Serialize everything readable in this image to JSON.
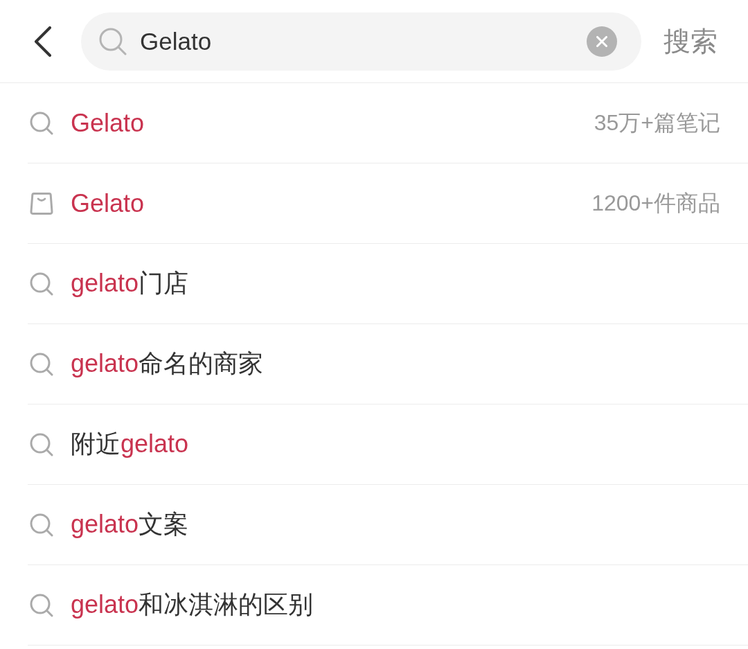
{
  "search": {
    "value": "Gelato",
    "submit_label": "搜索"
  },
  "suggestions": [
    {
      "kind": "search",
      "parts": [
        {
          "text": "Gelato",
          "highlighted": true
        }
      ],
      "count": "35万+篇笔记"
    },
    {
      "kind": "product",
      "parts": [
        {
          "text": "Gelato",
          "highlighted": true
        }
      ],
      "count": "1200+件商品"
    },
    {
      "kind": "search",
      "parts": [
        {
          "text": "gelato",
          "highlighted": true
        },
        {
          "text": "门店",
          "highlighted": false
        }
      ]
    },
    {
      "kind": "search",
      "parts": [
        {
          "text": "gelato",
          "highlighted": true
        },
        {
          "text": "命名的商家",
          "highlighted": false
        }
      ]
    },
    {
      "kind": "search",
      "parts": [
        {
          "text": "附近",
          "highlighted": false
        },
        {
          "text": "gelato",
          "highlighted": true
        }
      ]
    },
    {
      "kind": "search",
      "parts": [
        {
          "text": "gelato",
          "highlighted": true
        },
        {
          "text": "文案",
          "highlighted": false
        }
      ]
    },
    {
      "kind": "search",
      "parts": [
        {
          "text": "gelato",
          "highlighted": true
        },
        {
          "text": "和冰淇淋的区别",
          "highlighted": false
        }
      ]
    }
  ]
}
